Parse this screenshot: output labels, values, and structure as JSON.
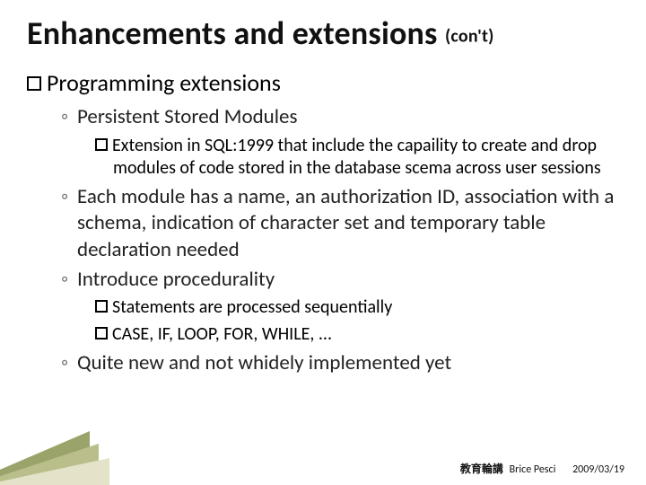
{
  "title_main": "Enhancements and extensions",
  "title_suffix": "(con't)",
  "lvl1_heading": "Programming extensions",
  "b1": "Persistent Stored Modules",
  "b1_sub": "Extension in SQL:1999 that include the capaility to create and drop modules of code stored in the database scema across user sessions",
  "b2": "Each module has a name, an authorization ID, association with a schema, indication of character set and temporary table declaration needed",
  "b3": "Introduce procedurality",
  "b3_sub1": "Statements are processed sequentially",
  "b3_sub2": "CASE, IF, LOOP, FOR, WHILE, ...",
  "b4": "Quite new and not whidely implemented yet",
  "footer_label": "教育輪講",
  "footer_author": "Brice Pesci",
  "footer_date": "2009/03/19"
}
